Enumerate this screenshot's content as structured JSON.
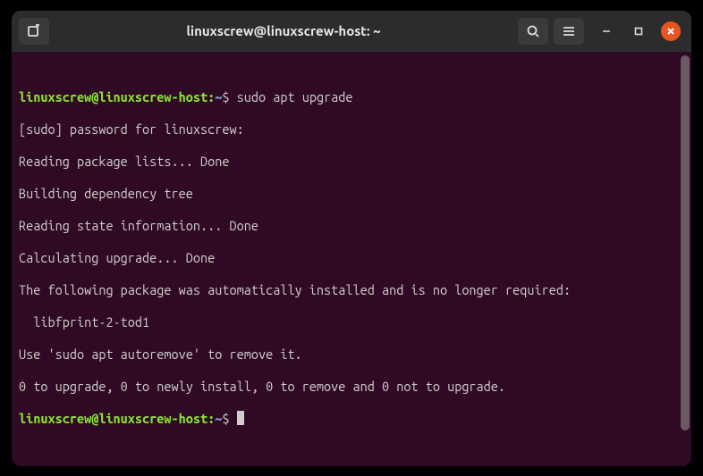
{
  "titlebar": {
    "title": "linuxscrew@linuxscrew-host: ~",
    "icons": {
      "newtab": "new-tab-icon",
      "search": "search-icon",
      "menu": "hamburger-icon",
      "minimize": "minimize-icon",
      "maximize": "maximize-icon",
      "close": "close-icon"
    }
  },
  "prompt": {
    "user_host": "linuxscrew@linuxscrew-host",
    "colon": ":",
    "path": "~",
    "dollar": "$"
  },
  "lines": {
    "cmd1": "sudo apt upgrade",
    "out1": "[sudo] password for linuxscrew:",
    "out2": "Reading package lists... Done",
    "out3": "Building dependency tree",
    "out4": "Reading state information... Done",
    "out5": "Calculating upgrade... Done",
    "out6": "The following package was automatically installed and is no longer required:",
    "out7": "  libfprint-2-tod1",
    "out8": "Use 'sudo apt autoremove' to remove it.",
    "out9": "0 to upgrade, 0 to newly install, 0 to remove and 0 not to upgrade."
  }
}
